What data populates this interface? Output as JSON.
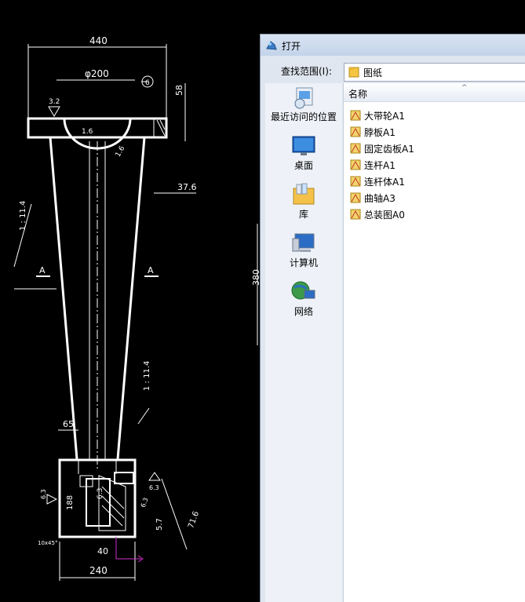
{
  "cad": {
    "dims": {
      "d440": "440",
      "d200": "φ200",
      "balloon": "6",
      "d58": "58",
      "d3_2a": "3.2",
      "d1_6a": "1.6",
      "d1_6b": "1.6",
      "d37_6": "37.6",
      "taper_a": "1 : 11.4",
      "section_a_left": "A",
      "section_a_right": "A",
      "d380": "380",
      "taper_b": "1 : 11.4",
      "d65": "65",
      "d6_3a": "6.3",
      "d6_3b": "6.3",
      "d6_3c": "6.3",
      "d188": "188",
      "d6_3d": "6.3",
      "d5_7": "5.7",
      "d71_6": "71.6",
      "chamfer": "10x45°",
      "d40": "40",
      "d240": "240"
    }
  },
  "dialog": {
    "title": "打开",
    "look_in_label": "查找范围(I):",
    "look_in_value": "图纸",
    "places": [
      {
        "label": "最近访问的位置",
        "icon": "recent-places-icon"
      },
      {
        "label": "桌面",
        "icon": "desktop-icon"
      },
      {
        "label": "库",
        "icon": "libraries-icon"
      },
      {
        "label": "计算机",
        "icon": "computer-icon"
      },
      {
        "label": "网络",
        "icon": "network-icon"
      }
    ],
    "column_header": "名称",
    "files": [
      "大带轮A1",
      "脖板A1",
      "固定齿板A1",
      "连杆A1",
      "连杆体A1",
      "曲轴A3",
      "总装图A0"
    ]
  }
}
